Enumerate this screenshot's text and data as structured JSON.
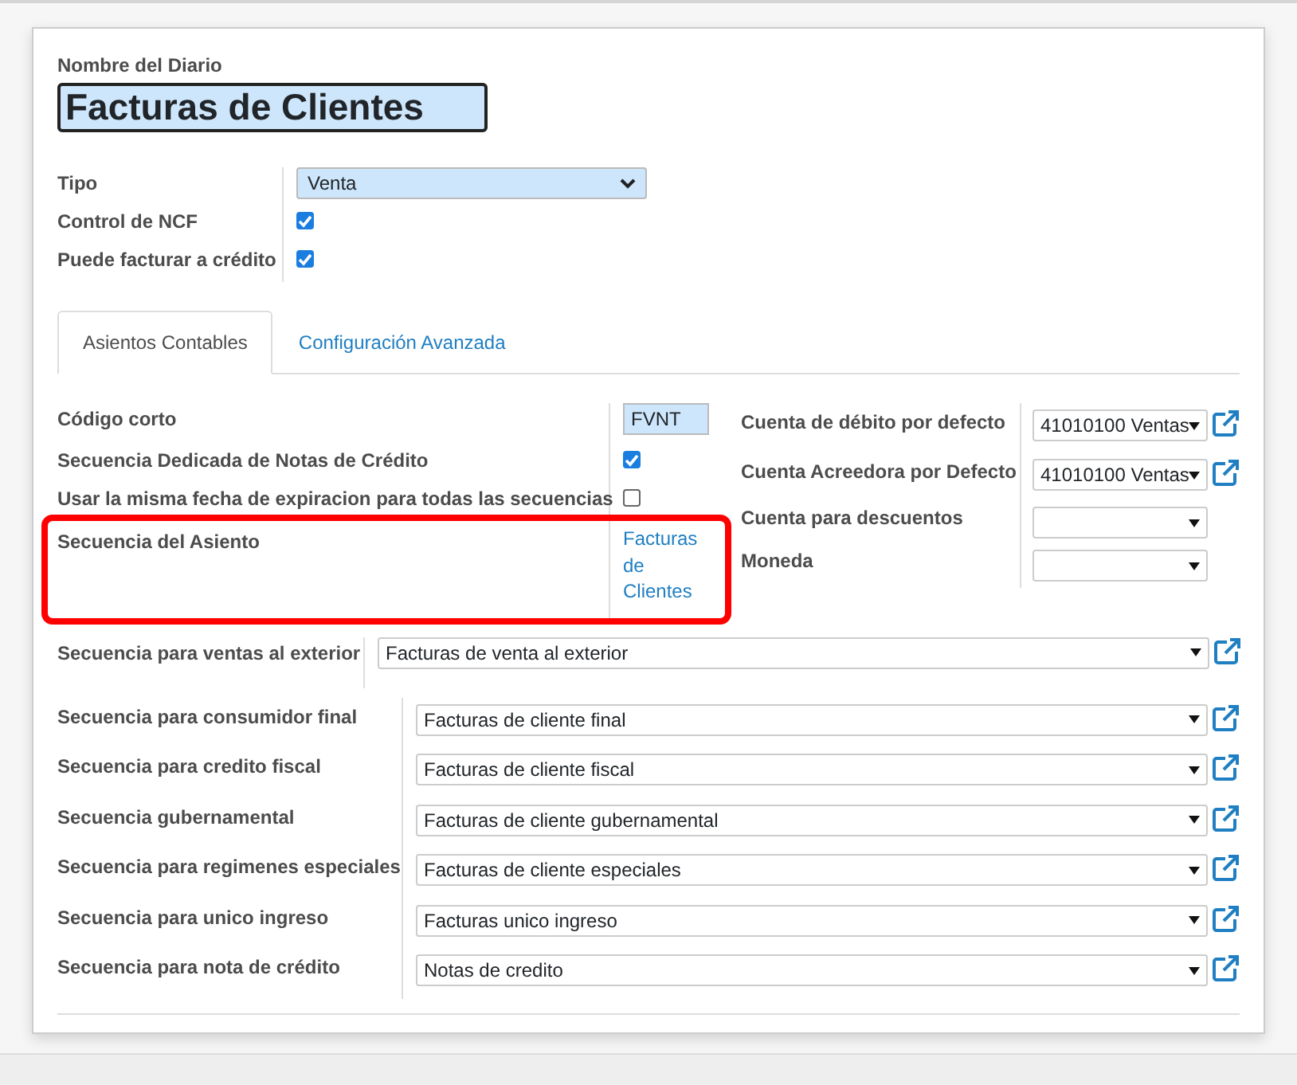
{
  "journal_name": {
    "label": "Nombre del Diario",
    "value": "Facturas de Clientes"
  },
  "general_fields": [
    {
      "label": "Tipo",
      "kind": "select",
      "value": "Venta"
    },
    {
      "label": "Control de NCF",
      "kind": "checkbox",
      "checked": true
    },
    {
      "label": "Puede facturar a crédito",
      "kind": "checkbox",
      "checked": true
    }
  ],
  "tabs": [
    {
      "label": "Asientos Contables",
      "selected": true
    },
    {
      "label": "Configuración Avanzada",
      "selected": false
    }
  ],
  "tab_left_fields": [
    {
      "label": "Código corto",
      "kind": "input",
      "value": "FVNT",
      "highlighted": false
    },
    {
      "label": "Secuencia Dedicada de Notas de Crédito",
      "kind": "checkbox",
      "checked": true,
      "highlighted": false
    },
    {
      "label": "Usar la misma fecha de expiracion para todas las secuencias",
      "kind": "checkbox",
      "checked": false,
      "highlighted": false
    },
    {
      "label": "Secuencia del Asiento",
      "kind": "link",
      "value": "Facturas de Clientes",
      "highlighted": true
    }
  ],
  "tab_right_fields": [
    {
      "label": "Cuenta de débito por defecto",
      "value": "41010100 Ventas",
      "external_link": true
    },
    {
      "label": "Cuenta Acreedora por Defecto",
      "value": "41010100 Ventas",
      "external_link": true
    },
    {
      "label": "Cuenta para descuentos",
      "external_link": false
    },
    {
      "label": "Moneda",
      "external_link": false
    }
  ],
  "exterior_sequence": {
    "label": "Secuencia para ventas al exterior",
    "value": "Facturas de venta al exterior",
    "external_link": true
  },
  "sequences": [
    {
      "label": "Secuencia para consumidor final",
      "value": "Facturas de cliente final",
      "external_link": true
    },
    {
      "label": "Secuencia para credito fiscal",
      "value": "Facturas de cliente fiscal",
      "external_link": true
    },
    {
      "label": "Secuencia gubernamental",
      "value": "Facturas de cliente gubernamental",
      "external_link": true
    },
    {
      "label": "Secuencia para regimenes especiales",
      "value": "Facturas de cliente especiales",
      "external_link": true
    },
    {
      "label": "Secuencia para unico ingreso",
      "value": "Facturas unico ingreso",
      "external_link": true
    },
    {
      "label": "Secuencia para nota de crédito",
      "value": "Notas de credito",
      "external_link": true
    }
  ]
}
